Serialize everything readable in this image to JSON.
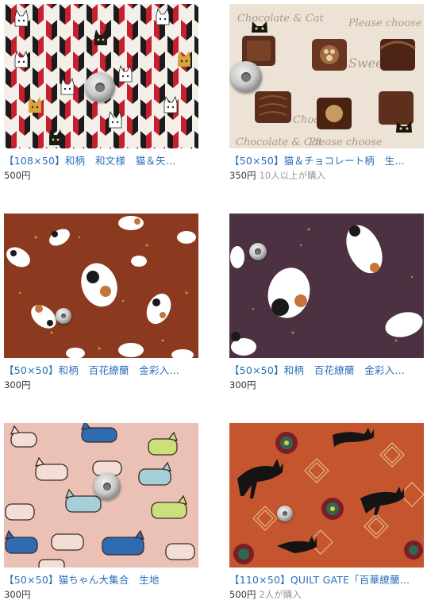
{
  "products": [
    {
      "title": "【108×50】和柄　和文様　猫＆矢…",
      "price": "500円",
      "buyers": "",
      "image_icon": "cat-arrow-feather-fabric-image"
    },
    {
      "title": "【50×50】猫＆チョコレート柄　生…",
      "price": "350円",
      "buyers": "10人以上が購入",
      "image_icon": "cat-chocolate-fabric-image",
      "fabric_text": [
        "Chocolate & Cat",
        "Please choose",
        "Sweet",
        "Choco",
        "Chocolate & Cat",
        "Please choose"
      ]
    },
    {
      "title": "【50×50】和柄　百花繚蘭　金彩入…",
      "price": "300円",
      "buyers": "",
      "image_icon": "calico-cat-brown-fabric-image"
    },
    {
      "title": "【50×50】和柄　百花繚蘭　金彩入…",
      "price": "300円",
      "buyers": "",
      "image_icon": "calico-cat-purple-fabric-image"
    },
    {
      "title": "【50×50】猫ちゃん大集合　生地",
      "price": "300円",
      "buyers": "",
      "image_icon": "cat-parade-pink-fabric-image"
    },
    {
      "title": "【110×50】QUILT GATE「百華繚蘭…",
      "price": "500円",
      "buyers": "2人が購入",
      "image_icon": "black-cat-orange-fabric-image"
    }
  ]
}
